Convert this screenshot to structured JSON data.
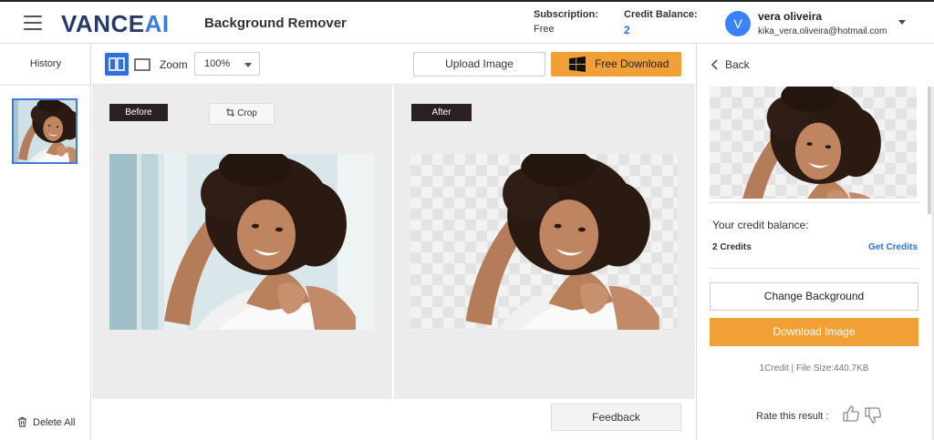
{
  "header": {
    "logo_main": "VANCE",
    "logo_ai": "AI",
    "app_title": "Background Remover",
    "subscription_label": "Subscription:",
    "subscription_value": "Free",
    "credit_balance_label": "Credit Balance:",
    "credit_balance_value": "2",
    "user": {
      "avatar_letter": "V",
      "name": "vera oliveira",
      "email": "kika_vera.oliveira@hotmail.com"
    }
  },
  "sidebar": {
    "title": "History",
    "delete_all": "Delete All"
  },
  "toolbar": {
    "zoom_label": "Zoom",
    "zoom_value": "100%",
    "upload_label": "Upload Image",
    "free_download_label": "Free Download"
  },
  "canvas": {
    "before_label": "Before",
    "after_label": "After",
    "crop_label": "Crop"
  },
  "feedback_label": "Feedback",
  "right_panel": {
    "back_label": "Back",
    "credit_balance_label": "Your credit balance:",
    "credits_count": "2 Credits",
    "get_credits": "Get Credits",
    "change_background": "Change Background",
    "download_image": "Download Image",
    "file_info": "1Credit | File Size:440.7KB",
    "rate_label": "Rate this result :"
  },
  "colors": {
    "accent_blue": "#2f6fe0",
    "download_orange": "#f0a035",
    "logo_navy": "#2a3a68"
  },
  "icons": [
    "hamburger-icon",
    "split-view-icon",
    "single-view-icon",
    "windows-icon",
    "crop-icon",
    "trash-icon",
    "chevron-left-icon",
    "thumbs-up-icon",
    "thumbs-down-icon",
    "caret-down-icon"
  ]
}
